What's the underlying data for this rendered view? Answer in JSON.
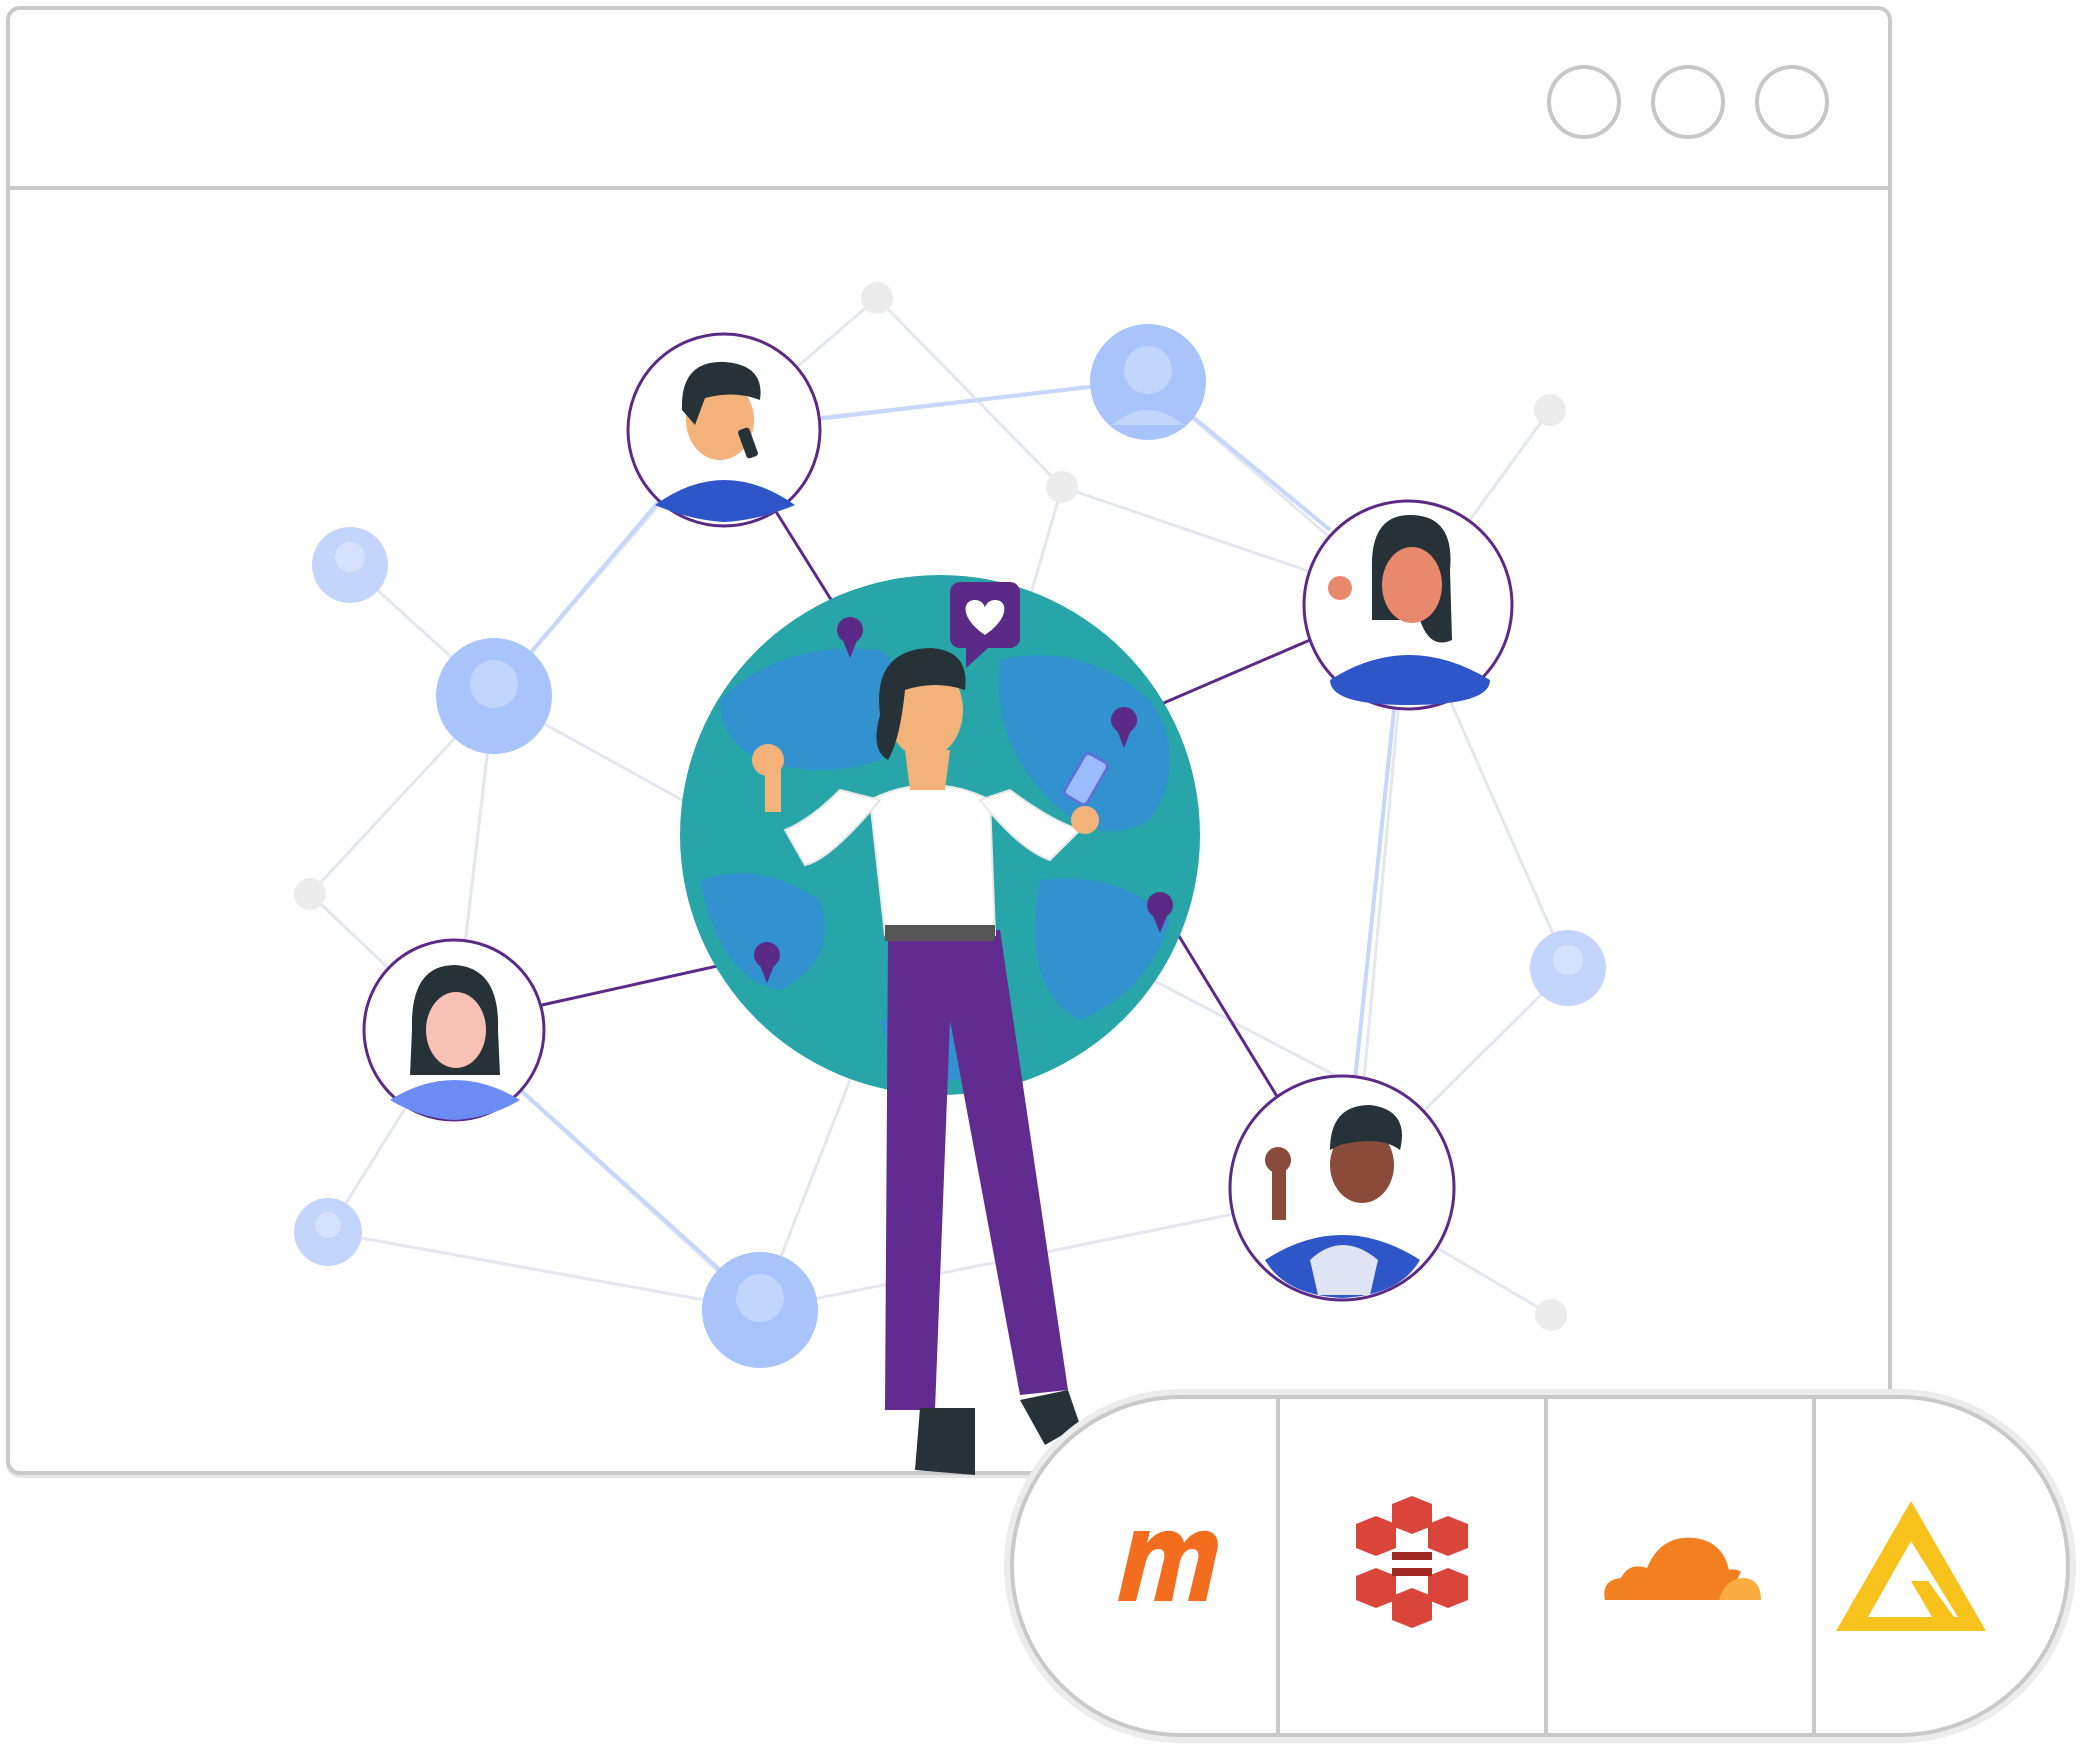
{
  "window": {
    "controls": [
      "window-button-1",
      "window-button-2",
      "window-button-3"
    ]
  },
  "illustration": {
    "theme": "global-network-connections",
    "icons": [
      "globe-icon",
      "heart-message-icon",
      "location-pin-icon",
      "person-avatar-icon"
    ]
  },
  "integrations": {
    "logos": [
      {
        "name": "mastodon-style-m-logo",
        "color": "#f36d1e"
      },
      {
        "name": "aws-cube-logo",
        "color": "#d9453a"
      },
      {
        "name": "cloudflare-cloud-logo",
        "color": "#f38020"
      },
      {
        "name": "triangle-logo",
        "color": "#f6c21b"
      }
    ]
  },
  "colors": {
    "border": "#c9c9c9",
    "accent_purple": "#5b2a86",
    "globe_teal": "#27a5a8",
    "globe_blue": "#3292d0",
    "node_blue": "#a9c4fb"
  }
}
